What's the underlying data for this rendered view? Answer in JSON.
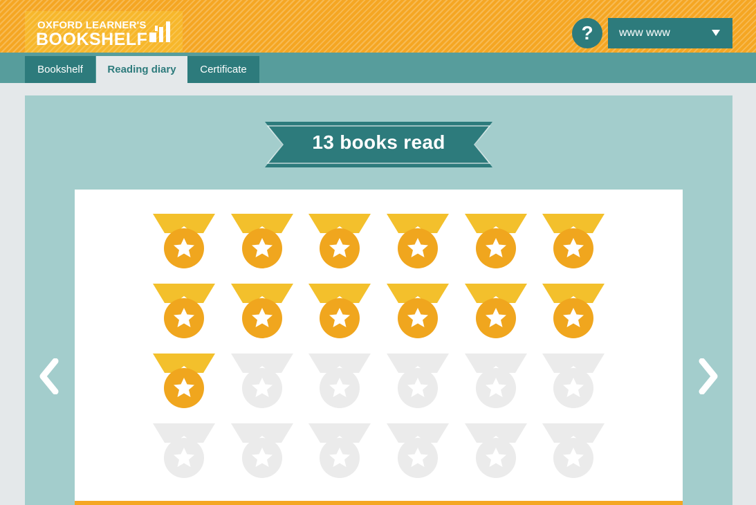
{
  "header": {
    "logo_line1": "OXFORD LEARNER'S",
    "logo_line2": "BOOKSHELF",
    "help_label": "?",
    "user_name": "www www"
  },
  "tabs": [
    {
      "label": "Bookshelf",
      "active": false
    },
    {
      "label": "Reading diary",
      "active": true
    },
    {
      "label": "Certificate",
      "active": false
    }
  ],
  "diary": {
    "banner_text": "13 books read",
    "books_read": 13,
    "medal_slots": 24
  },
  "colors": {
    "brand_orange": "#f5a623",
    "teal_dark": "#2d7b7c",
    "teal_tab_bar": "#579d9c",
    "panel_bg": "#a3cdcc",
    "medal_ribbon": "#f3c02c",
    "medal_disc": "#f0a61e",
    "medal_locked": "#ebebeb"
  },
  "icons": {
    "help": "question-icon",
    "dropdown": "chevron-down-icon",
    "prev": "chevron-left-icon",
    "next": "chevron-right-icon",
    "medal": "medal-icon"
  }
}
